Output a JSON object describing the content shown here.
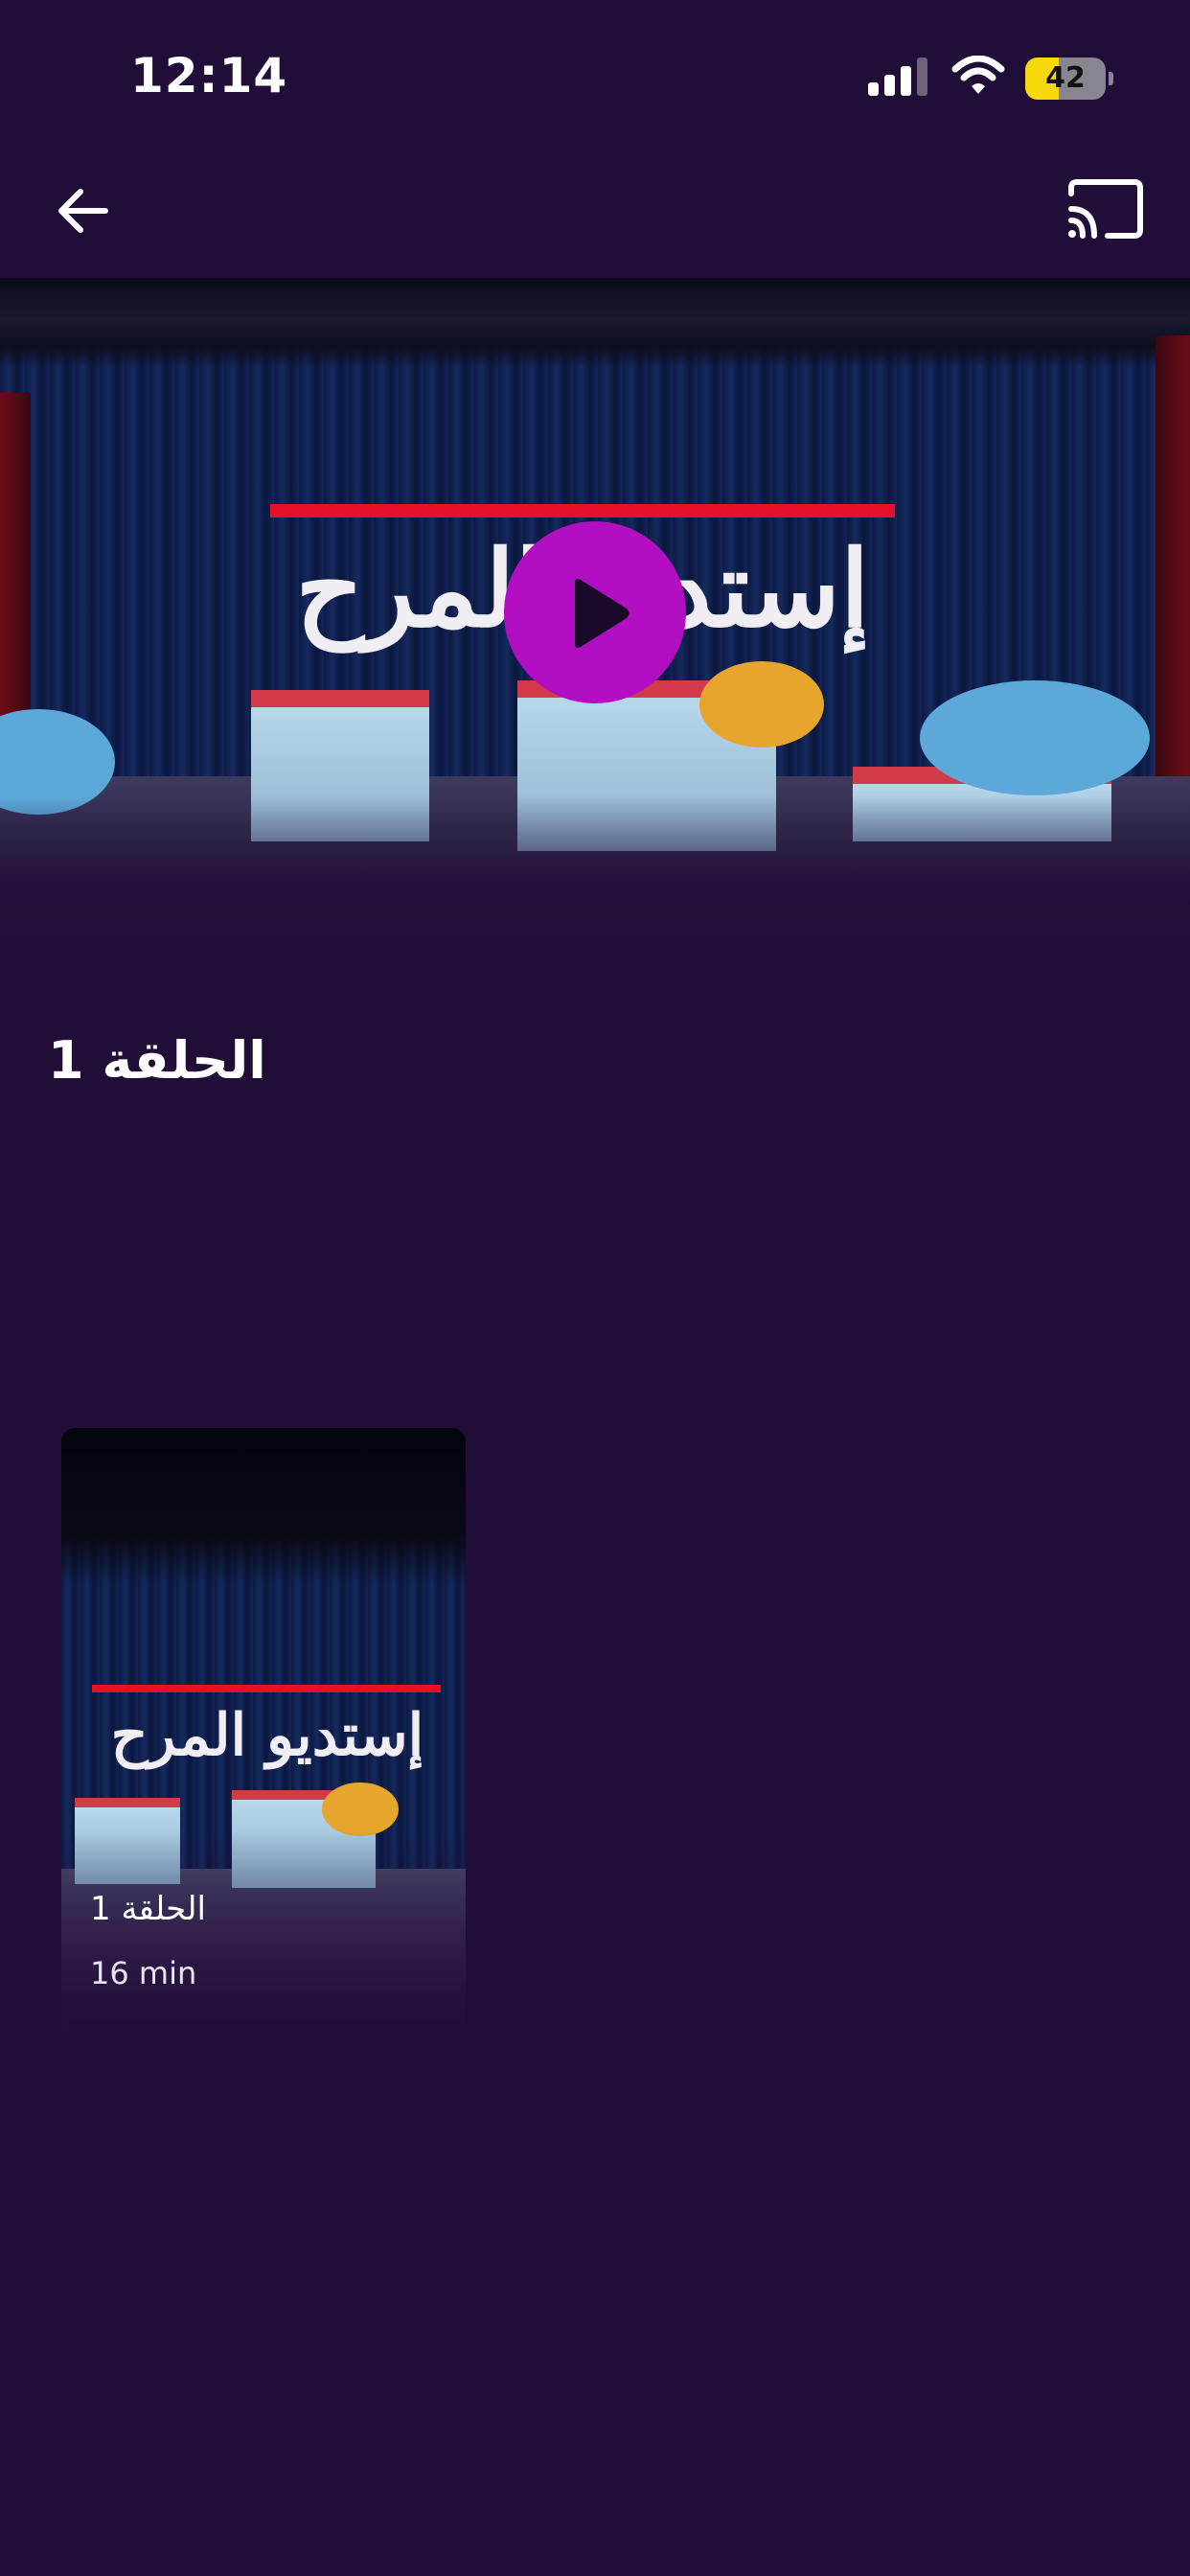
{
  "status_bar": {
    "time": "12:14",
    "battery_percent": "42",
    "battery_level": 0.42,
    "signal_icon": "cellular-signal-icon",
    "wifi_icon": "wifi-icon"
  },
  "nav": {
    "back_icon": "arrow-left-icon",
    "cast_icon": "cast-icon"
  },
  "hero": {
    "show_title": "إستديو المرح",
    "play_icon": "play-icon"
  },
  "episode": {
    "title": "الحلقة 1"
  },
  "episodes": [
    {
      "label": "الحلقة 1",
      "duration": "16 min",
      "thumbnail_title": "إستديو المرح"
    }
  ],
  "colors": {
    "background": "#210e38",
    "accent": "#b30fc2",
    "battery": "#f5d90a"
  }
}
